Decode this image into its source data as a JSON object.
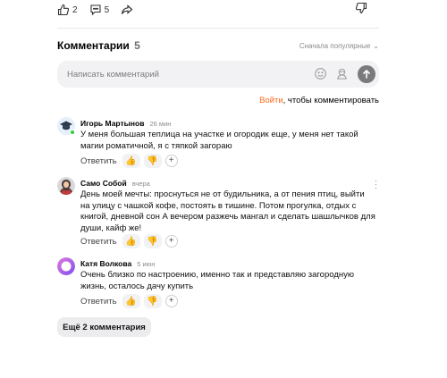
{
  "reactions": {
    "likes": "2",
    "comments": "5"
  },
  "comments_header": {
    "title": "Комментарии",
    "count": "5",
    "sort_label": "Сначала популярные"
  },
  "comment_input": {
    "placeholder": "Написать комментарий"
  },
  "login_prompt": {
    "link": "Войти",
    "suffix": ", чтобы комментировать"
  },
  "comments": [
    {
      "author": "Игорь Мартынов",
      "time": "26 мин",
      "text": "У меня большая теплица на участке и огородик еще, у меня нет такой магии роматичной, я с тяпкой загораю",
      "reply_label": "Ответить"
    },
    {
      "author": "Само Собой",
      "time": "вчера",
      "text": "День моей мечты: проснуться не от будильника, а от пения птиц, выйти на улицу с чашкой кофе, постоять в тишине. Потом прогулка, отдых с книгой, дневной сон А вечером разжечь мангал и сделать шашлычков для души, кайф же!",
      "reply_label": "Ответить"
    },
    {
      "author": "Катя Волкова",
      "time": "5 июн",
      "text": "Очень близко по настроению, именно так и представляю загородную жизнь, осталось дачу купить",
      "reply_label": "Ответить"
    }
  ],
  "more_button": {
    "label": "Ещё 2 комментария"
  },
  "colors": {
    "accent": "#ff6a1a",
    "online": "#2ecc40",
    "input_bg": "#f2f2f4"
  }
}
